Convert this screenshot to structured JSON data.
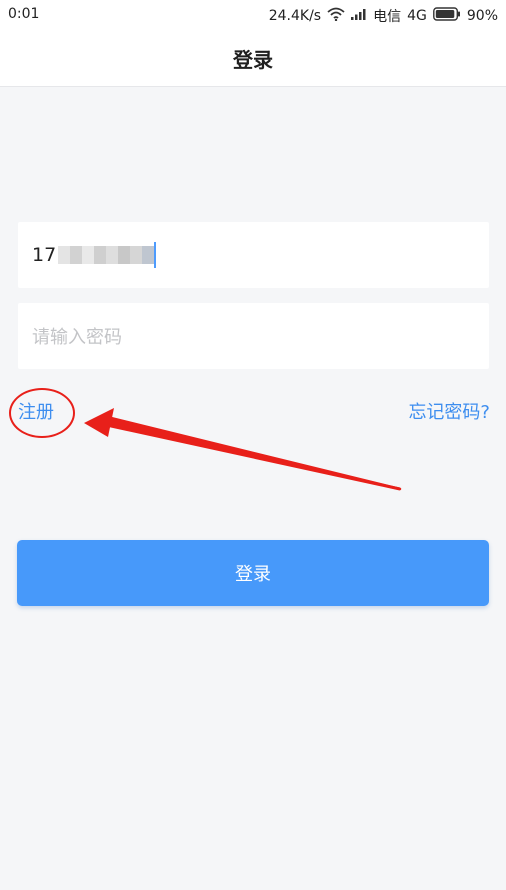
{
  "status_bar": {
    "time": "0:01",
    "speed": "24.4K/s",
    "carrier": "电信",
    "network": "4G",
    "battery": "90%"
  },
  "header": {
    "title": "登录"
  },
  "form": {
    "phone_prefix": "17",
    "password_placeholder": "请输入密码"
  },
  "links": {
    "register": "注册",
    "forgot_password": "忘记密码?"
  },
  "login_button": {
    "label": "登录"
  },
  "colors": {
    "accent": "#4799fa",
    "link": "#3e8eef",
    "annotation": "#e8201a",
    "background": "#f5f6f8"
  },
  "icons": [
    "wifi-icon",
    "signal-icon",
    "battery-icon"
  ]
}
